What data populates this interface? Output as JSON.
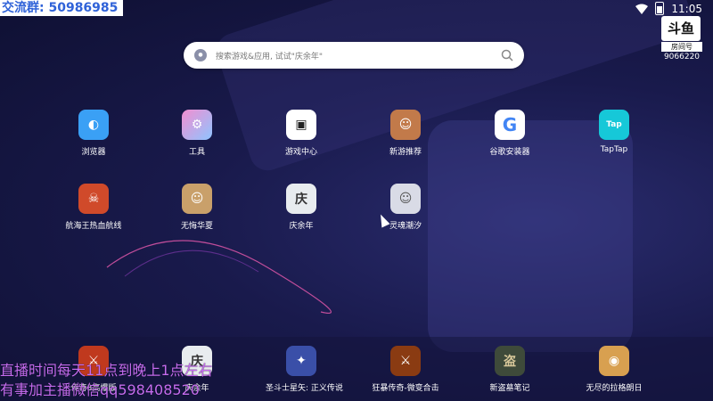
{
  "overlay": {
    "group_text": "交流群: 50986985",
    "note_line1": "直播时间每天11点到晚上1点左右",
    "note_line2": "有事加主播微信qq598408520"
  },
  "status": {
    "time": "11:05"
  },
  "room": {
    "logo": "斗鱼",
    "label": "房间号",
    "number": "9066220"
  },
  "search": {
    "placeholder": "搜索游戏&应用, 试试\"庆余年\""
  },
  "apps_row1": [
    {
      "label": "浏览器",
      "icon": "browser-icon",
      "color": "#3aa0f5"
    },
    {
      "label": "工具",
      "icon": "tools-icon",
      "color": "#e08fd2"
    },
    {
      "label": "游戏中心",
      "icon": "gamepad-icon",
      "color": "#ffffff"
    },
    {
      "label": "新游推荐",
      "icon": "new-games-icon",
      "color": "#c27a4a"
    },
    {
      "label": "谷歌安装器",
      "icon": "google-icon",
      "color": "#ffffff"
    },
    {
      "label": "TapTap",
      "icon": "taptap-icon",
      "color": "#16c8d8"
    }
  ],
  "apps_row2": [
    {
      "label": "航海王热血航线",
      "icon": "onepiece-icon",
      "color": "#d04a2a"
    },
    {
      "label": "无悔华夏",
      "icon": "wuhui-icon",
      "color": "#c9a06a"
    },
    {
      "label": "庆余年",
      "icon": "qingyunian-icon",
      "color": "#e8ecef"
    },
    {
      "label": "灵魂潮汐",
      "icon": "linghun-icon",
      "color": "#d9dbe6"
    }
  ],
  "dock_apps": [
    {
      "label": "传奇3高爆版",
      "icon": "chuanqi-icon",
      "color": "#c0391e"
    },
    {
      "label": "庆余年",
      "icon": "qingyunian-icon",
      "color": "#e8ecef"
    },
    {
      "label": "圣斗士星矢: 正义传说",
      "icon": "saint-icon",
      "color": "#3a4fa8"
    },
    {
      "label": "狂暴传奇-微变合击",
      "icon": "kuangbao-icon",
      "color": "#8a3b12"
    },
    {
      "label": "新盗墓笔记",
      "icon": "daomu-icon",
      "color": "#3e4a3a"
    },
    {
      "label": "无尽的拉格朗日",
      "icon": "lagrange-icon",
      "color": "#d8a050"
    }
  ]
}
